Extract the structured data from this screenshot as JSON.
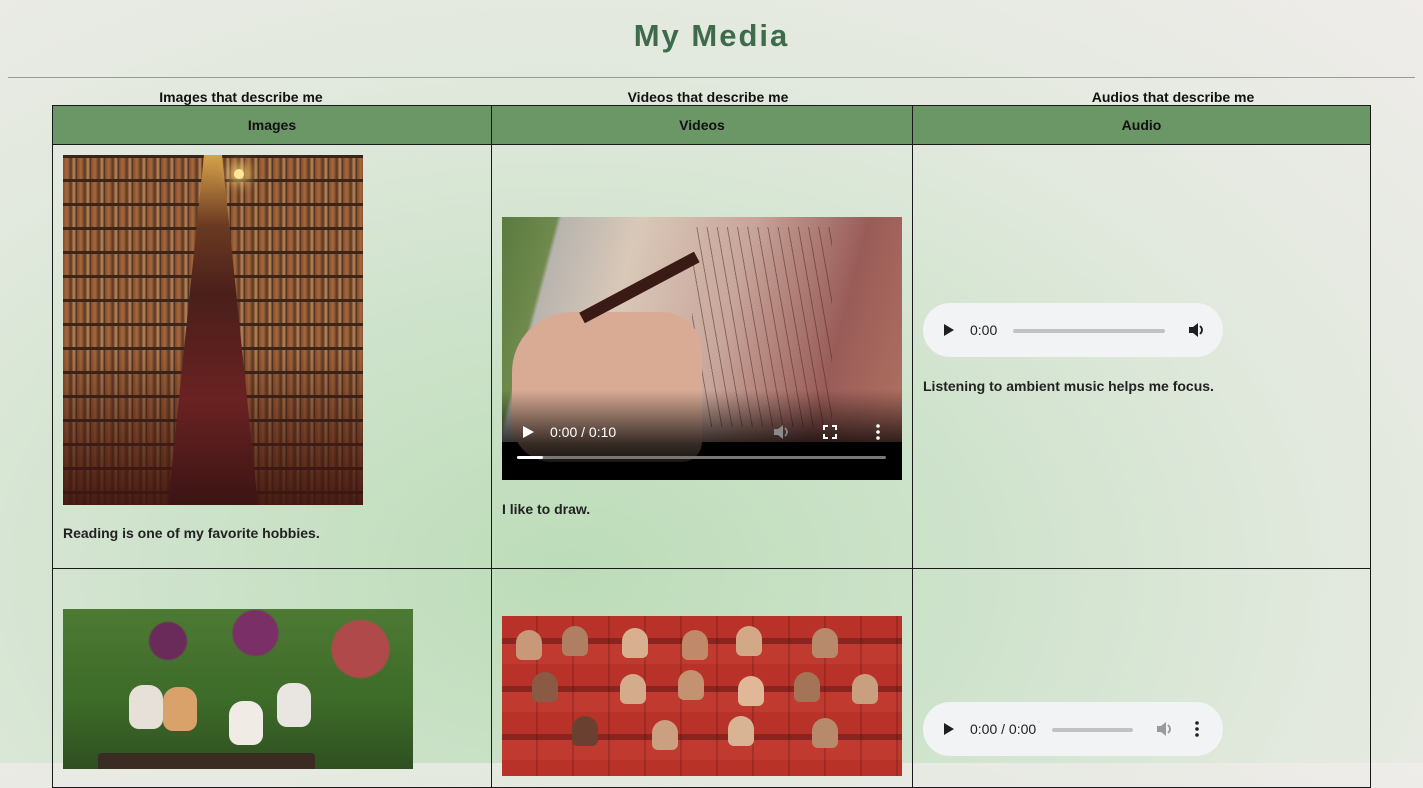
{
  "page": {
    "title": "My Media",
    "captions": {
      "images": "Images that describe me",
      "videos": "Videos that describe me",
      "audios": "Audios that describe me"
    }
  },
  "table": {
    "headers": [
      "Images",
      "Videos",
      "Audio"
    ],
    "rows": [
      {
        "image_description": "Reading is one of my favorite hobbies.",
        "video_time": "0:00 / 0:10",
        "video_progress": 0.07,
        "video_description": "I like to draw.",
        "audio_time": "0:00",
        "audio_description": "Listening to ambient music helps me focus."
      },
      {
        "audio_time": "0:00 / 0:00"
      }
    ]
  },
  "icons": {
    "play": "play-icon",
    "volume": "volume-icon",
    "volume_muted": "volume-disabled-icon",
    "fullscreen": "fullscreen-icon",
    "more": "more-options-icon"
  },
  "colors": {
    "title": "#3d6b4c",
    "header_bg": "#6b9666",
    "player_bg": "#f1f3f4"
  }
}
